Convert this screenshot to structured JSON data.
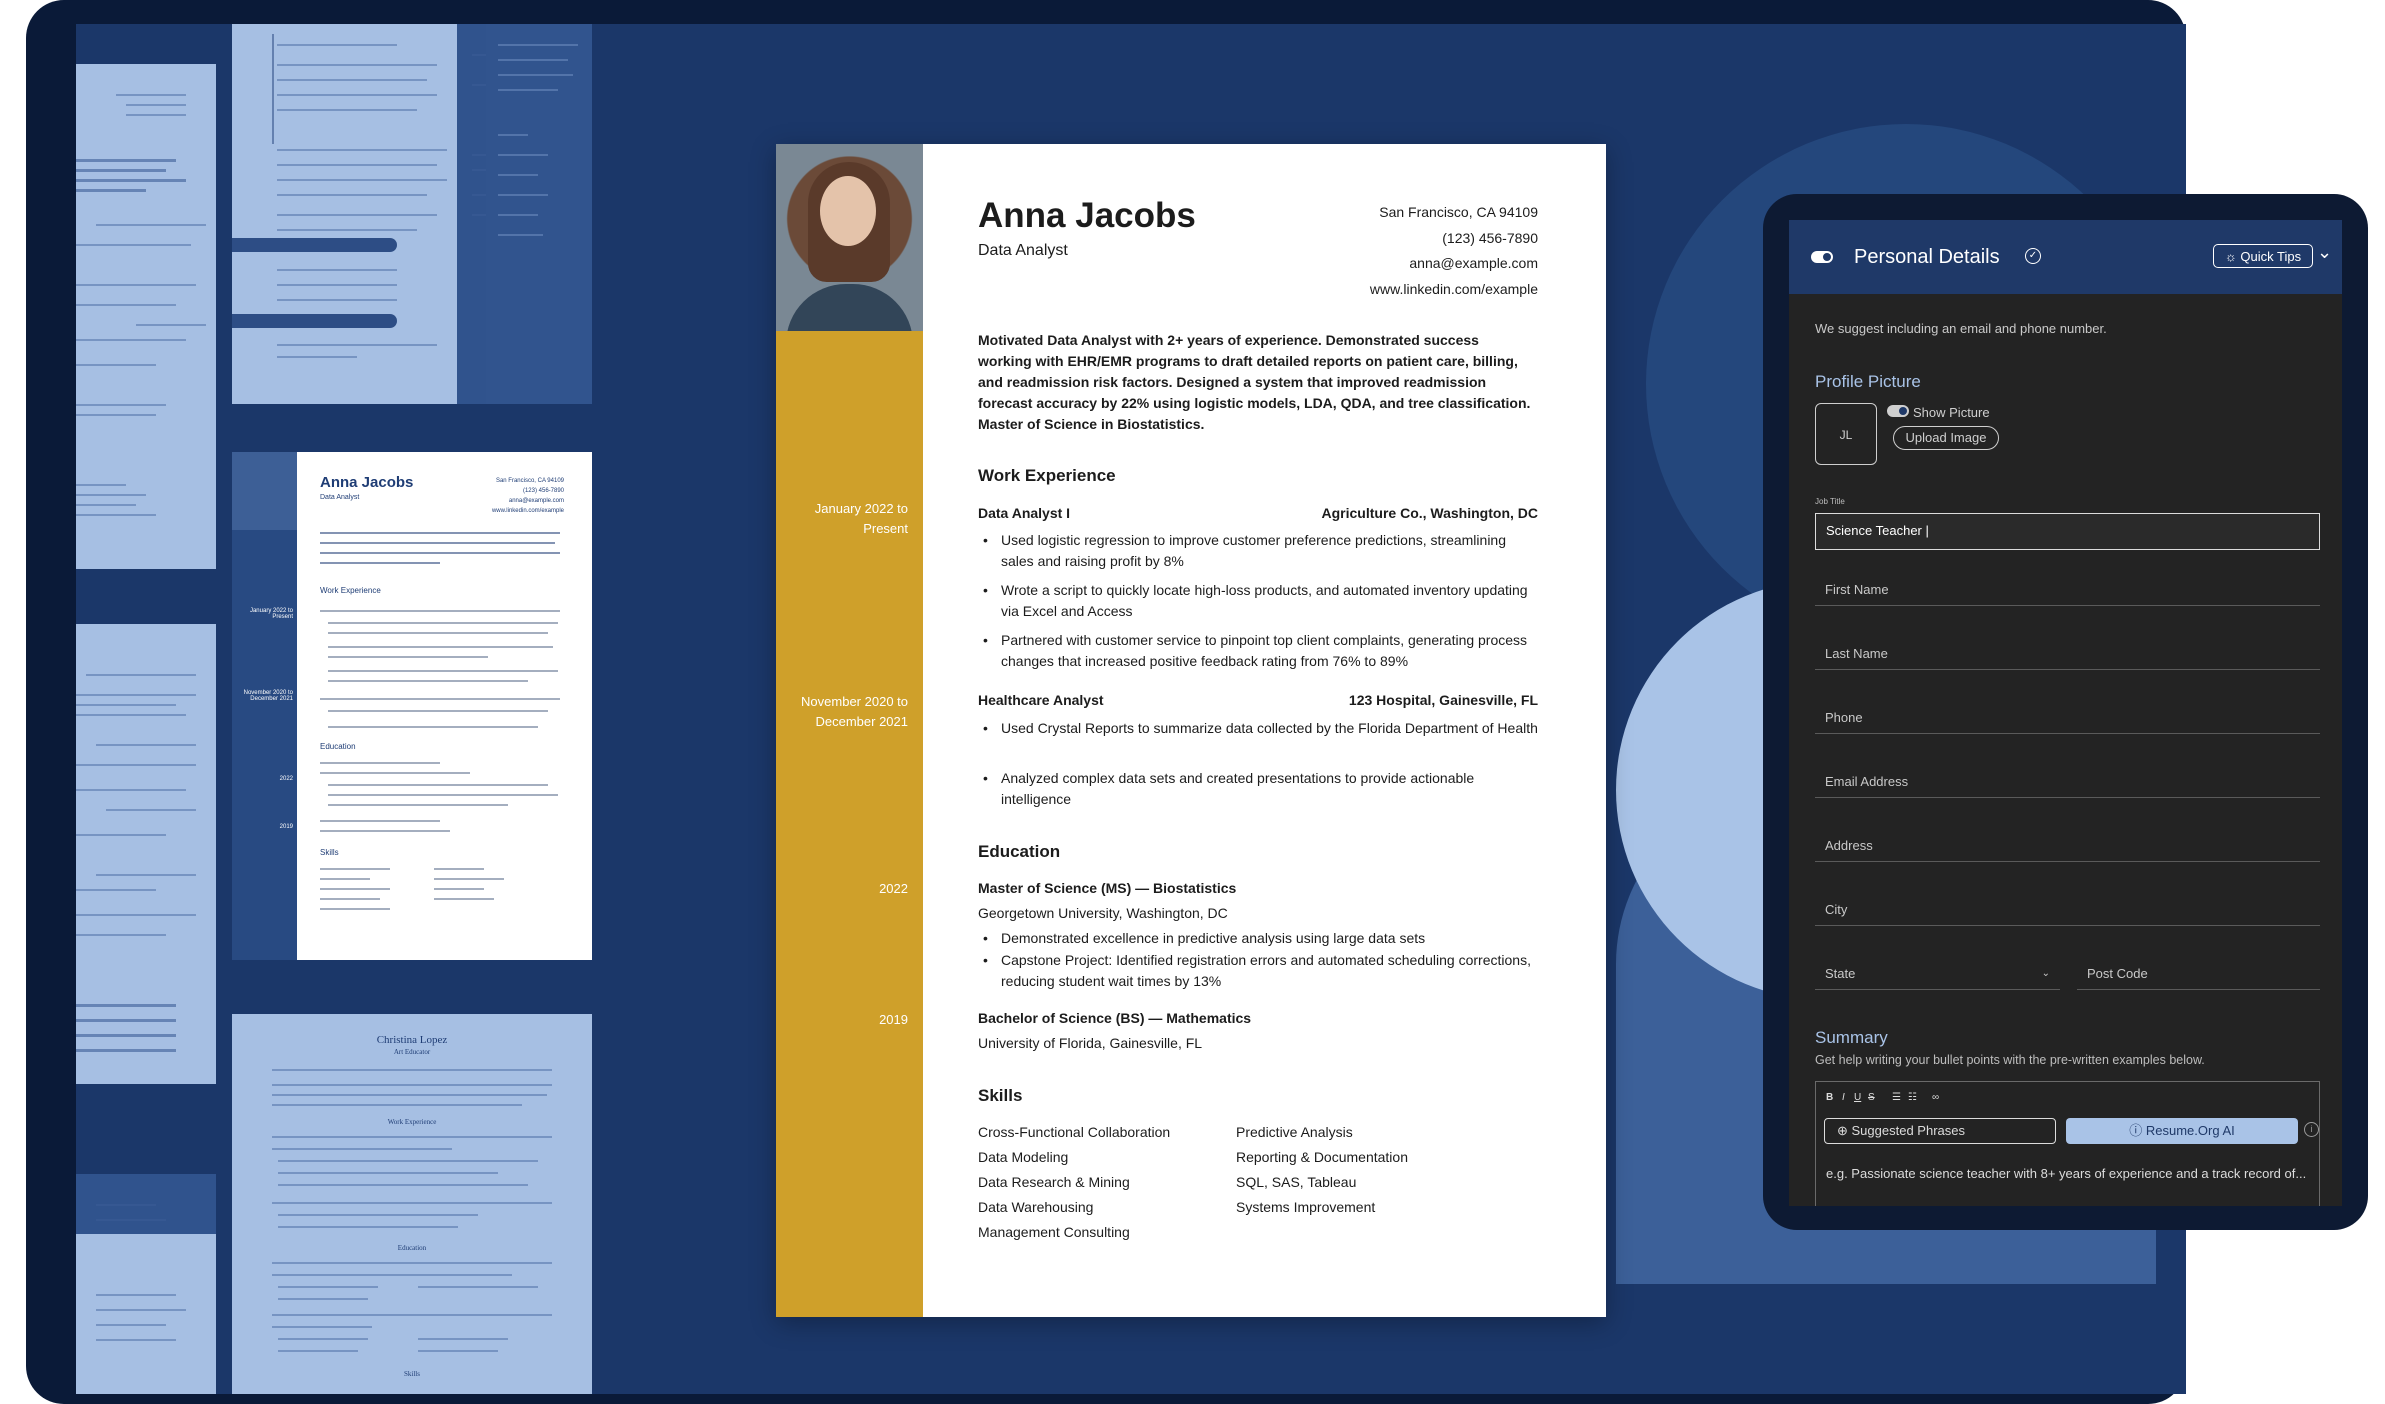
{
  "resume": {
    "name": "Anna Jacobs",
    "title": "Data Analyst",
    "contact": [
      "San Francisco, CA 94109",
      "(123) 456-7890",
      "anna@example.com",
      "www.linkedin.com/example"
    ],
    "summary": "Motivated Data Analyst with 2+ years of experience. Demonstrated success working with EHR/EMR programs to draft detailed reports on patient care, billing, and readmission risk factors. Designed a system that improved readmission forecast accuracy by 22% using logistic models, LDA, QDA, and tree classification. Master of Science in Biostatistics.",
    "dates": [
      "January 2022 to Present",
      "November 2020 to December 2021",
      "2022",
      "2019"
    ],
    "work_heading": "Work Experience",
    "jobs": [
      {
        "role": "Data Analyst I",
        "company": "Agriculture Co., Washington, DC",
        "bullets": [
          "Used logistic regression to improve customer preference predictions, streamlining sales and raising profit by 8%",
          "Wrote a script to quickly locate high-loss products, and automated inventory updating via Excel and Access",
          "Partnered with customer service to pinpoint top client complaints, generating process changes that increased positive feedback rating from 76% to 89%"
        ]
      },
      {
        "role": "Healthcare Analyst",
        "company": "123 Hospital, Gainesville, FL",
        "bullets": [
          "Used Crystal Reports to summarize data collected by the Florida Department of Health",
          "Analyzed complex data sets and created presentations to provide actionable intelligence"
        ]
      }
    ],
    "education_heading": "Education",
    "education": [
      {
        "degree": "Master of Science (MS) — Biostatistics",
        "school": "Georgetown University, Washington, DC",
        "bullets": [
          "Demonstrated excellence in predictive analysis using large data sets",
          "Capstone Project: Identified registration errors and automated scheduling corrections, reducing student wait times by 13%"
        ]
      },
      {
        "degree": "Bachelor of Science (BS) — Mathematics",
        "school": "University of Florida, Gainesville, FL",
        "bullets": []
      }
    ],
    "skills_heading": "Skills",
    "skills_col1": [
      "Cross-Functional Collaboration",
      "Data Modeling",
      "Data Research & Mining",
      "Data Warehousing",
      "Management Consulting"
    ],
    "skills_col2": [
      "Predictive Analysis",
      "Reporting & Documentation",
      "SQL, SAS, Tableau",
      "Systems Improvement"
    ]
  },
  "thumb_resume": {
    "name": "Anna Jacobs",
    "title": "Data Analyst",
    "contact": [
      "San Francisco, CA 94109",
      "(123) 456-7890",
      "anna@example.com",
      "www.linkedin.com/example"
    ],
    "headings": [
      "Work Experience",
      "Education",
      "Skills"
    ],
    "dates": [
      "January 2022 to Present",
      "November 2020 to December 2021",
      "2022",
      "2019"
    ]
  },
  "thumb_christina": {
    "name": "Christina Lopez",
    "title": "Art Educator",
    "headings": [
      "Work Experience",
      "Education",
      "Skills"
    ]
  },
  "panel": {
    "title": "Personal Details",
    "quick_tips": "Quick Tips",
    "hint": "We suggest including an email and phone number.",
    "profile_picture_label": "Profile Picture",
    "avatar_initials": "JL",
    "show_picture": "Show Picture",
    "upload_image": "Upload Image",
    "job_title_label": "Job Title",
    "job_title_value": "Science Teacher |",
    "fields": [
      "First Name",
      "Last Name",
      "Phone",
      "Email Address",
      "Address",
      "City"
    ],
    "state_label": "State",
    "post_code_label": "Post Code",
    "summary_label": "Summary",
    "summary_sub": "Get help writing your bullet points with the pre-written examples below.",
    "toolbar": [
      "B",
      "I",
      "U",
      "S"
    ],
    "suggested_phrases": "Suggested Phrases",
    "ai_button": "Resume.Org AI",
    "summary_placeholder": "e.g. Passionate science teacher with 8+ years of experience and a track record of..."
  },
  "colors": {
    "frame": "#0a1a38",
    "screen": "#1b3769",
    "accent_gold": "#cfa02a",
    "panel_header": "#1f3968",
    "accent_light_blue": "#a9c3e7"
  }
}
